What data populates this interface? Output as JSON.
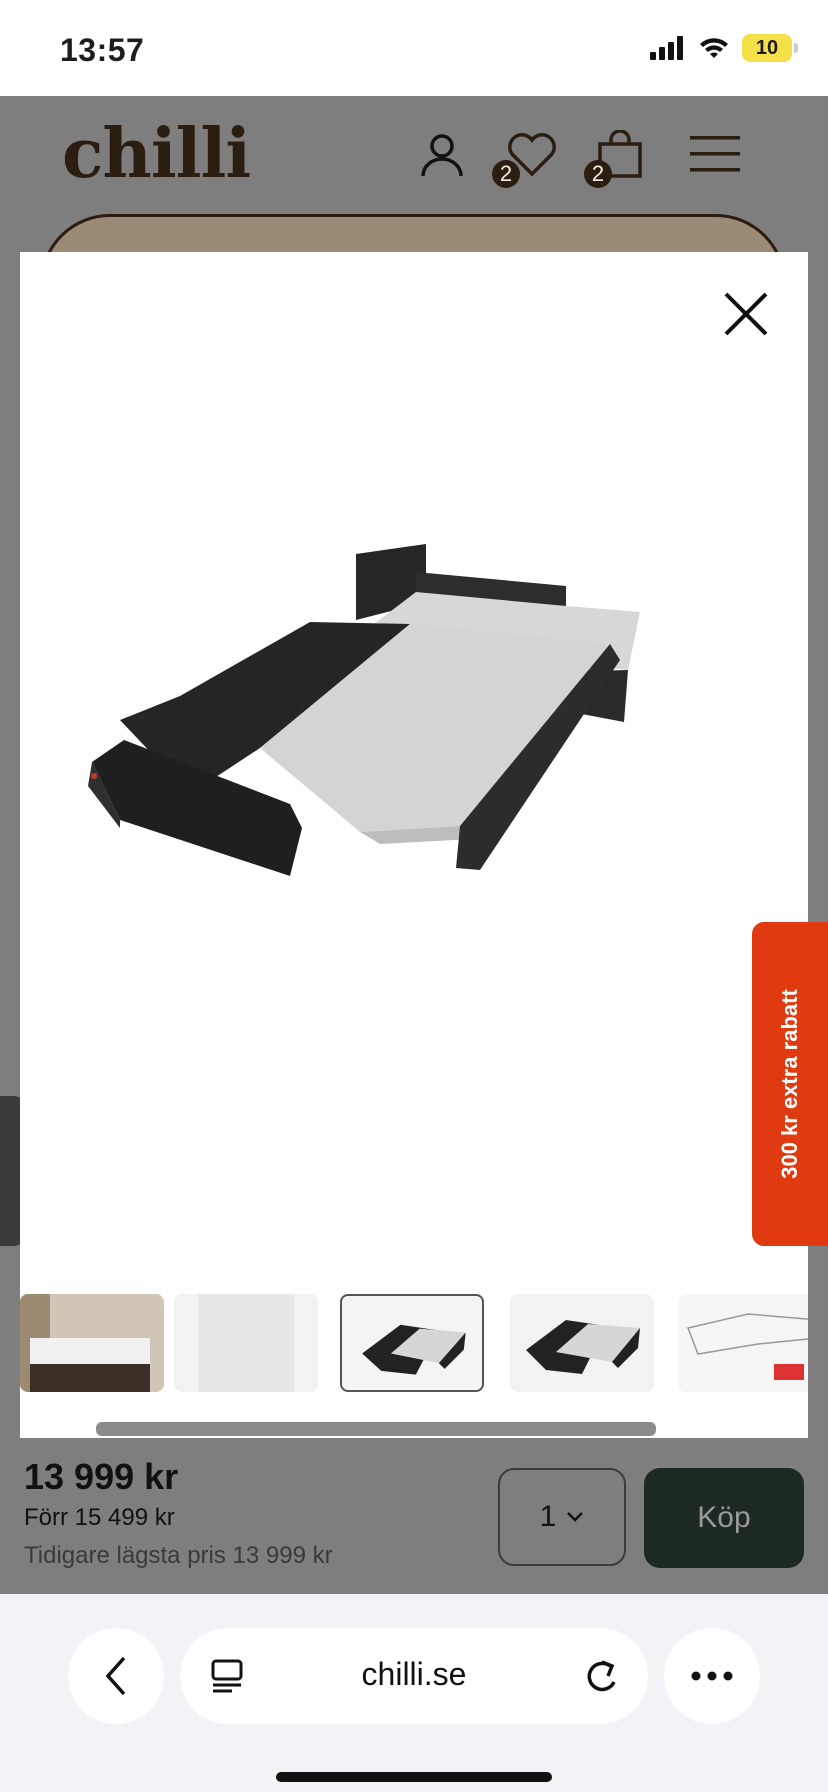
{
  "status_bar": {
    "time": "13:57",
    "battery": "10",
    "icons": [
      "cellular-signal-icon",
      "wifi-icon",
      "battery-icon"
    ]
  },
  "site": {
    "logo": "chilli",
    "header_icons": [
      "account-icon",
      "wishlist-heart-icon",
      "cart-bag-icon",
      "menu-hamburger-icon"
    ],
    "wishlist_count": "2",
    "cart_count": "2"
  },
  "modal": {
    "close_icon": "close-icon",
    "main_image": "corner sofa bed in black and light grey fabric, opened as bed",
    "thumbnails": [
      {
        "name": "living-room-photo",
        "selected": false
      },
      {
        "name": "fabric-swatch",
        "selected": false
      },
      {
        "name": "sofa-bed-open-angle-1",
        "selected": true
      },
      {
        "name": "sofa-bed-open-angle-2",
        "selected": false
      },
      {
        "name": "dimension-sketch",
        "selected": false
      }
    ]
  },
  "sale_tab": {
    "label": "300 kr extra rabatt",
    "color": "#e03a10"
  },
  "price_bar": {
    "price": "13 999 kr",
    "before": "Förr 15 499 kr",
    "lowest": "Tidigare lägsta pris 13 999 kr",
    "quantity": "1",
    "buy_label": "Köp"
  },
  "browser": {
    "url": "chilli.se",
    "icons": [
      "back-chevron-icon",
      "reader-icon",
      "reload-icon",
      "more-dots-icon"
    ]
  },
  "colors": {
    "brand_brown": "#2b1d10",
    "buy_green": "#1d2a22",
    "overlay_gray": "#7e7e7e"
  }
}
